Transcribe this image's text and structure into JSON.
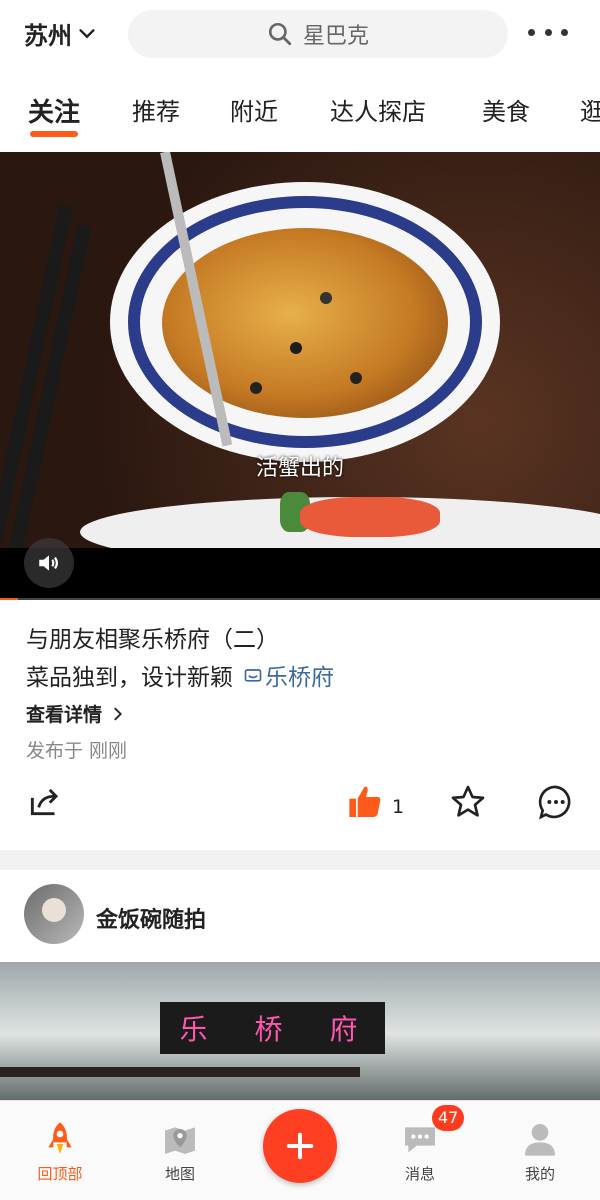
{
  "header": {
    "city": "苏州",
    "search_placeholder": "星巴克",
    "more_icon": "more-dots-icon"
  },
  "tabs": [
    {
      "label": "关注",
      "active": true
    },
    {
      "label": "推荐"
    },
    {
      "label": "附近"
    },
    {
      "label": "达人探店"
    },
    {
      "label": "美食"
    },
    {
      "label": "逛"
    }
  ],
  "video": {
    "caption": "活蟹出的",
    "progress": 0.03
  },
  "post": {
    "title": "与朋友相聚乐桥府（二）",
    "description": "菜品独到，设计新颖",
    "shop": "乐桥府",
    "details_label": "查看详情",
    "published": "发布于 刚刚",
    "like_count": "1"
  },
  "user_post": {
    "username": "金饭碗随拍"
  },
  "bottom_nav": {
    "items": [
      {
        "label": "回顶部",
        "icon": "rocket-icon",
        "active": true
      },
      {
        "label": "地图",
        "icon": "map-icon"
      },
      {
        "label": "消息",
        "icon": "message-icon",
        "badge": "47"
      },
      {
        "label": "我的",
        "icon": "profile-icon"
      }
    ]
  },
  "colors": {
    "accent": "#ff5a1a",
    "fab": "#ff3f22",
    "link": "#3b6aa3"
  }
}
